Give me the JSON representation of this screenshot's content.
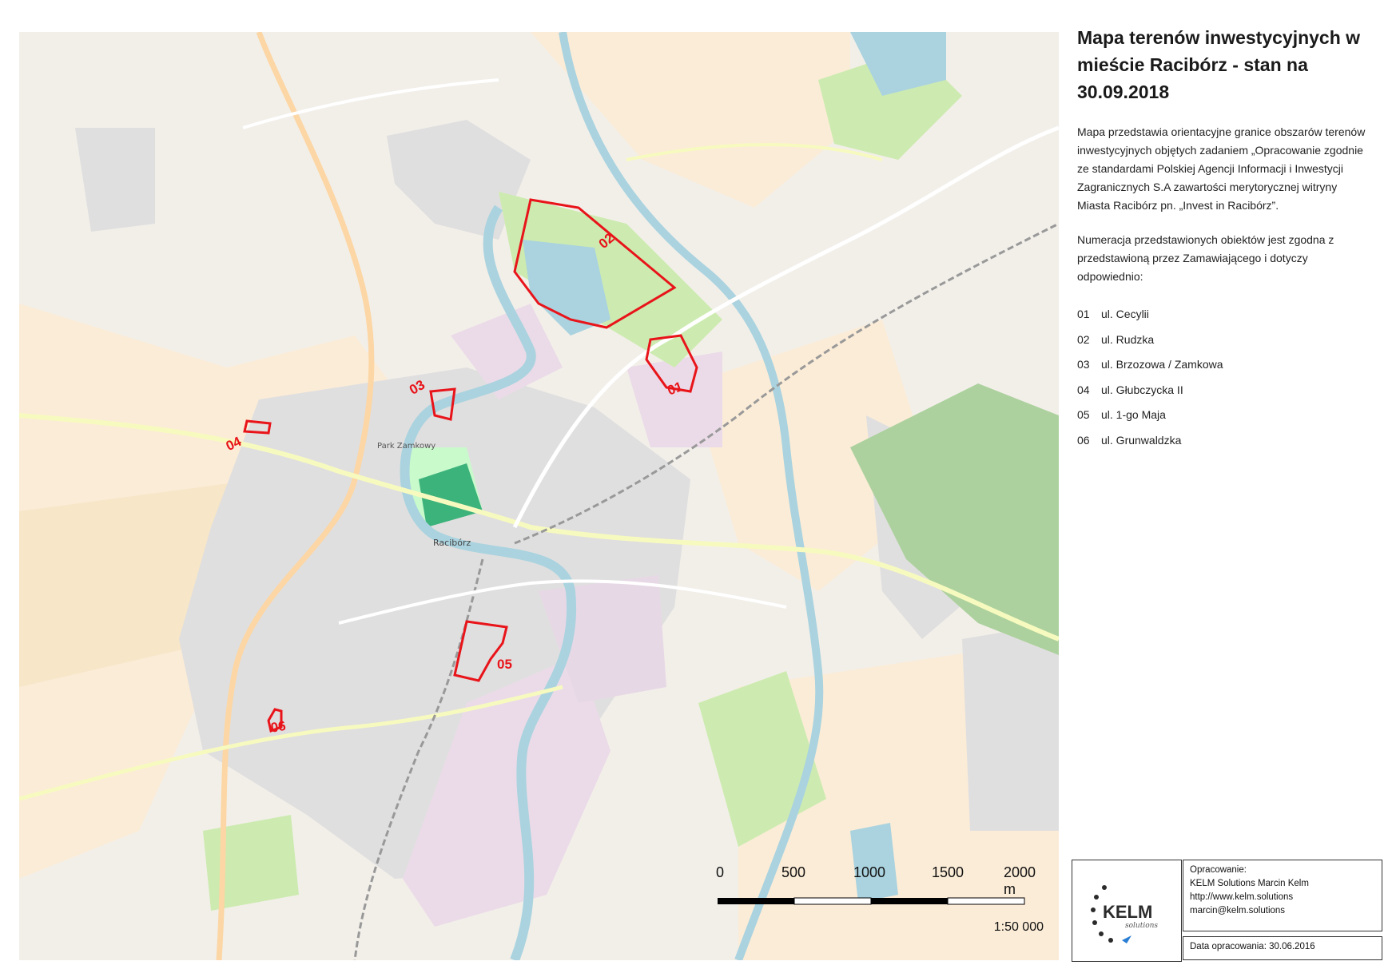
{
  "title": "Mapa terenów inwestycyjnych w mieście Racibórz - stan na 30.09.2018",
  "description": "Mapa przedstawia orientacyjne granice obszarów terenów inwestycyjnych objętych zadaniem „Opracowanie zgodnie ze standardami Polskiej Agencji Informacji i Inwestycji Zagranicznych S.A zawartości merytorycznej witryny Miasta Racibórz pn. „Invest in Racibórz”.",
  "numbering_note": "Numeracja przedstawionych obiektów jest zgodna z przedstawioną przez Zamawiającego i dotyczy odpowiednio:",
  "legend": [
    {
      "num": "01",
      "name": "ul. Cecylii"
    },
    {
      "num": "02",
      "name": "ul. Rudzka"
    },
    {
      "num": "03",
      "name": "ul. Brzozowa / Zamkowa"
    },
    {
      "num": "04",
      "name": "ul. Głubczycka II"
    },
    {
      "num": "05",
      "name": "ul. 1-go Maja"
    },
    {
      "num": "06",
      "name": "ul. Grunwaldzka"
    }
  ],
  "map_labels": {
    "p01": "01",
    "p02": "02",
    "p03": "03",
    "p04": "04",
    "p05": "05",
    "p06": "06",
    "city": "Racibórz",
    "park": "Park Zamkowy"
  },
  "scale": {
    "ticks": [
      "0",
      "500",
      "1000",
      "1500",
      "2000 m"
    ],
    "ratio": "1:50 000"
  },
  "credits": {
    "heading": "Opracowanie:",
    "company": "KELM Solutions Marcin Kelm",
    "url": "http://www.kelm.solutions",
    "email": "marcin@kelm.solutions",
    "date": "Data opracowania: 30.06.2016",
    "logo_text": "KELM",
    "logo_sub": "solutions"
  },
  "colors": {
    "investment_area_outline": "#e8141a",
    "river": "#aad3df",
    "forest": "#add19e",
    "farmland": "#fbecd7",
    "residential": "#e0dfdf",
    "industrial": "#ebdbe8"
  }
}
